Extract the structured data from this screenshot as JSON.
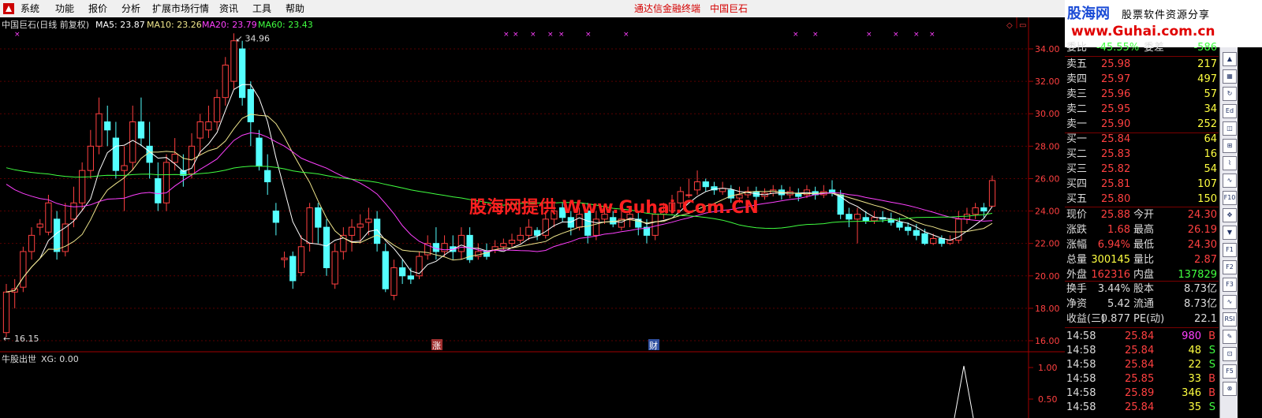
{
  "menu": {
    "items": [
      "系统",
      "功能",
      "报价",
      "分析",
      "扩展市场行情",
      "资讯",
      "工具",
      "帮助"
    ],
    "center_title": "通达信金融终端",
    "center_stock": "中国巨石"
  },
  "banner": {
    "logo_text": "股海网",
    "slogan": "股票软件资源分享",
    "url": "www.Guhai.com.cn"
  },
  "chart_header": {
    "title": "中国巨石(日线 前复权)",
    "ma": [
      {
        "label": "MA5: 23.87",
        "color": "#ffffff"
      },
      {
        "label": "MA10: 23.26",
        "color": "#f0e68c"
      },
      {
        "label": "MA20: 23.79",
        "color": "#ff40ff"
      },
      {
        "label": "MA60: 23.43",
        "color": "#40ff40"
      }
    ]
  },
  "watermark": "股海网提供 Www.Guhai.Com.CN",
  "markers": {
    "zhang": "涨",
    "cai": "财"
  },
  "indicator": {
    "name": "牛股出世",
    "value": "XG: 0.00",
    "axis": [
      "1.00",
      "0.50"
    ]
  },
  "chart_data": {
    "type": "candlestick",
    "y_axis_ticks": [
      "34.00",
      "32.00",
      "30.00",
      "28.00",
      "26.00",
      "24.00",
      "22.00",
      "20.00",
      "18.00",
      "16.00"
    ],
    "ylim": [
      15.4,
      35.4
    ],
    "high_label": "34.96",
    "low_label": "16.15",
    "up_color": "#ff4040",
    "down_color": "#54ffff",
    "candles": [
      {
        "o": 16.5,
        "c": 19.0,
        "h": 19.5,
        "l": 16.2
      },
      {
        "o": 19.0,
        "c": 19.2,
        "h": 19.8,
        "l": 18.0
      },
      {
        "o": 19.3,
        "c": 21.5,
        "h": 21.8,
        "l": 19.0
      },
      {
        "o": 21.5,
        "c": 22.5,
        "h": 23.0,
        "l": 21.0
      },
      {
        "o": 23.0,
        "c": 23.2,
        "h": 23.5,
        "l": 22.5
      },
      {
        "o": 22.7,
        "c": 24.5,
        "h": 25.0,
        "l": 22.5
      },
      {
        "o": 23.5,
        "c": 21.5,
        "h": 24.0,
        "l": 21.0
      },
      {
        "o": 21.5,
        "c": 23.2,
        "h": 24.5,
        "l": 21.2
      },
      {
        "o": 23.5,
        "c": 24.5,
        "h": 25.5,
        "l": 23.0
      },
      {
        "o": 24.5,
        "c": 26.5,
        "h": 27.0,
        "l": 24.0
      },
      {
        "o": 26.5,
        "c": 28.0,
        "h": 29.0,
        "l": 26.0
      },
      {
        "o": 28.0,
        "c": 30.0,
        "h": 31.0,
        "l": 27.5
      },
      {
        "o": 29.5,
        "c": 29.0,
        "h": 30.5,
        "l": 28.0
      },
      {
        "o": 28.5,
        "c": 26.5,
        "h": 29.5,
        "l": 26.0
      },
      {
        "o": 26.5,
        "c": 26.8,
        "h": 28.0,
        "l": 24.0
      },
      {
        "o": 27.0,
        "c": 29.5,
        "h": 30.5,
        "l": 26.5
      },
      {
        "o": 29.5,
        "c": 28.5,
        "h": 31.0,
        "l": 28.0
      },
      {
        "o": 28.0,
        "c": 27.0,
        "h": 29.5,
        "l": 26.0
      },
      {
        "o": 26.0,
        "c": 24.5,
        "h": 27.0,
        "l": 24.0
      },
      {
        "o": 24.5,
        "c": 27.0,
        "h": 27.5,
        "l": 24.0
      },
      {
        "o": 27.0,
        "c": 27.5,
        "h": 28.5,
        "l": 26.5
      },
      {
        "o": 26.5,
        "c": 26.2,
        "h": 27.5,
        "l": 25.5
      },
      {
        "o": 26.3,
        "c": 28.0,
        "h": 28.8,
        "l": 26.0
      },
      {
        "o": 28.5,
        "c": 29.5,
        "h": 30.0,
        "l": 27.5
      },
      {
        "o": 29.0,
        "c": 29.5,
        "h": 30.5,
        "l": 28.5
      },
      {
        "o": 29.5,
        "c": 31.0,
        "h": 31.5,
        "l": 29.0
      },
      {
        "o": 31.0,
        "c": 33.0,
        "h": 33.5,
        "l": 30.5
      },
      {
        "o": 32.0,
        "c": 34.5,
        "h": 34.96,
        "l": 31.5
      },
      {
        "o": 34.0,
        "c": 31.0,
        "h": 34.5,
        "l": 30.5
      },
      {
        "o": 31.5,
        "c": 29.5,
        "h": 32.0,
        "l": 28.0
      },
      {
        "o": 28.5,
        "c": 26.8,
        "h": 29.0,
        "l": 26.5
      },
      {
        "o": 26.5,
        "c": 25.8,
        "h": 27.5,
        "l": 25.0
      },
      {
        "o": 24.0,
        "c": 23.3,
        "h": 24.5,
        "l": 22.5
      },
      {
        "o": 21.0,
        "c": 21.1,
        "h": 21.5,
        "l": 20.5
      },
      {
        "o": 21.2,
        "c": 19.7,
        "h": 21.5,
        "l": 19.2
      },
      {
        "o": 20.2,
        "c": 21.8,
        "h": 22.5,
        "l": 20.0
      },
      {
        "o": 22.0,
        "c": 24.2,
        "h": 24.5,
        "l": 21.5
      },
      {
        "o": 24.2,
        "c": 23.0,
        "h": 24.5,
        "l": 22.0
      },
      {
        "o": 23.0,
        "c": 20.5,
        "h": 23.5,
        "l": 20.0
      },
      {
        "o": 19.5,
        "c": 21.5,
        "h": 22.0,
        "l": 19.2
      },
      {
        "o": 21.5,
        "c": 22.5,
        "h": 23.0,
        "l": 21.0
      },
      {
        "o": 22.5,
        "c": 23.0,
        "h": 23.5,
        "l": 21.5
      },
      {
        "o": 23.0,
        "c": 23.2,
        "h": 23.8,
        "l": 22.0
      },
      {
        "o": 23.3,
        "c": 23.5,
        "h": 24.2,
        "l": 22.5
      },
      {
        "o": 23.5,
        "c": 22.0,
        "h": 24.0,
        "l": 21.5
      },
      {
        "o": 21.5,
        "c": 19.2,
        "h": 22.0,
        "l": 19.0
      },
      {
        "o": 18.8,
        "c": 20.5,
        "h": 21.0,
        "l": 18.5
      },
      {
        "o": 20.5,
        "c": 20.0,
        "h": 21.0,
        "l": 19.5
      },
      {
        "o": 20.0,
        "c": 19.8,
        "h": 20.5,
        "l": 19.5
      },
      {
        "o": 20.0,
        "c": 21.2,
        "h": 21.5,
        "l": 19.8
      },
      {
        "o": 21.3,
        "c": 22.0,
        "h": 22.5,
        "l": 21.0
      },
      {
        "o": 22.0,
        "c": 21.5,
        "h": 23.0,
        "l": 21.0
      },
      {
        "o": 21.5,
        "c": 22.0,
        "h": 22.5,
        "l": 21.2
      },
      {
        "o": 21.8,
        "c": 21.5,
        "h": 22.5,
        "l": 21.0
      },
      {
        "o": 21.5,
        "c": 22.5,
        "h": 23.0,
        "l": 21.0
      },
      {
        "o": 22.5,
        "c": 21.0,
        "h": 23.0,
        "l": 20.8
      },
      {
        "o": 21.2,
        "c": 21.5,
        "h": 22.0,
        "l": 21.0
      },
      {
        "o": 21.5,
        "c": 21.2,
        "h": 22.0,
        "l": 21.0
      },
      {
        "o": 21.6,
        "c": 21.8,
        "h": 22.2,
        "l": 21.4
      },
      {
        "o": 21.8,
        "c": 22.0,
        "h": 22.3,
        "l": 21.6
      },
      {
        "o": 22.0,
        "c": 22.2,
        "h": 22.6,
        "l": 21.8
      },
      {
        "o": 22.2,
        "c": 22.5,
        "h": 23.0,
        "l": 22.0
      },
      {
        "o": 22.5,
        "c": 23.0,
        "h": 23.5,
        "l": 22.2
      },
      {
        "o": 22.8,
        "c": 22.5,
        "h": 23.0,
        "l": 22.2
      },
      {
        "o": 22.5,
        "c": 23.5,
        "h": 24.0,
        "l": 22.3
      },
      {
        "o": 23.5,
        "c": 24.0,
        "h": 24.5,
        "l": 23.0
      },
      {
        "o": 24.2,
        "c": 23.6,
        "h": 24.5,
        "l": 23.3
      },
      {
        "o": 23.6,
        "c": 23.0,
        "h": 24.0,
        "l": 22.5
      },
      {
        "o": 23.0,
        "c": 23.8,
        "h": 24.2,
        "l": 22.8
      },
      {
        "o": 24.0,
        "c": 22.5,
        "h": 24.5,
        "l": 22.0
      },
      {
        "o": 22.5,
        "c": 23.5,
        "h": 24.0,
        "l": 22.2
      },
      {
        "o": 23.5,
        "c": 23.8,
        "h": 24.2,
        "l": 23.2
      },
      {
        "o": 23.6,
        "c": 23.2,
        "h": 24.0,
        "l": 23.0
      },
      {
        "o": 23.0,
        "c": 23.5,
        "h": 24.0,
        "l": 22.8
      },
      {
        "o": 23.5,
        "c": 23.8,
        "h": 24.2,
        "l": 23.0
      },
      {
        "o": 23.5,
        "c": 23.0,
        "h": 24.0,
        "l": 22.5
      },
      {
        "o": 23.0,
        "c": 22.5,
        "h": 23.5,
        "l": 22.0
      },
      {
        "o": 22.5,
        "c": 23.8,
        "h": 24.0,
        "l": 22.2
      },
      {
        "o": 23.8,
        "c": 24.0,
        "h": 24.5,
        "l": 23.5
      },
      {
        "o": 24.0,
        "c": 24.5,
        "h": 25.0,
        "l": 23.8
      },
      {
        "o": 24.5,
        "c": 25.2,
        "h": 25.5,
        "l": 24.2
      },
      {
        "o": 25.0,
        "c": 25.0,
        "h": 26.0,
        "l": 24.8
      },
      {
        "o": 25.3,
        "c": 25.8,
        "h": 26.5,
        "l": 25.0
      },
      {
        "o": 25.8,
        "c": 25.5,
        "h": 26.0,
        "l": 25.2
      },
      {
        "o": 25.5,
        "c": 25.3,
        "h": 25.8,
        "l": 25.0
      },
      {
        "o": 25.2,
        "c": 25.4,
        "h": 25.8,
        "l": 25.0
      },
      {
        "o": 25.3,
        "c": 24.8,
        "h": 25.6,
        "l": 24.5
      },
      {
        "o": 24.8,
        "c": 25.0,
        "h": 25.5,
        "l": 24.5
      },
      {
        "o": 25.0,
        "c": 25.2,
        "h": 25.5,
        "l": 24.8
      },
      {
        "o": 25.2,
        "c": 24.9,
        "h": 25.5,
        "l": 24.6
      },
      {
        "o": 24.9,
        "c": 25.1,
        "h": 25.4,
        "l": 24.7
      },
      {
        "o": 25.1,
        "c": 25.3,
        "h": 25.6,
        "l": 24.9
      },
      {
        "o": 25.3,
        "c": 25.0,
        "h": 25.6,
        "l": 24.7
      },
      {
        "o": 25.0,
        "c": 25.2,
        "h": 25.5,
        "l": 24.8
      },
      {
        "o": 25.1,
        "c": 24.9,
        "h": 25.4,
        "l": 24.6
      },
      {
        "o": 25.0,
        "c": 25.3,
        "h": 25.6,
        "l": 24.8
      },
      {
        "o": 25.2,
        "c": 25.0,
        "h": 25.5,
        "l": 24.7
      },
      {
        "o": 25.0,
        "c": 25.2,
        "h": 25.6,
        "l": 24.8
      },
      {
        "o": 25.3,
        "c": 25.1,
        "h": 25.9,
        "l": 24.9
      },
      {
        "o": 25.0,
        "c": 23.8,
        "h": 25.3,
        "l": 23.5
      },
      {
        "o": 23.8,
        "c": 23.5,
        "h": 24.2,
        "l": 23.0
      },
      {
        "o": 23.5,
        "c": 23.8,
        "h": 24.2,
        "l": 22.0
      },
      {
        "o": 23.6,
        "c": 23.4,
        "h": 24.0,
        "l": 23.2
      },
      {
        "o": 23.4,
        "c": 23.6,
        "h": 24.0,
        "l": 23.2
      },
      {
        "o": 23.6,
        "c": 23.5,
        "h": 24.0,
        "l": 23.3
      },
      {
        "o": 23.5,
        "c": 23.3,
        "h": 23.9,
        "l": 23.1
      },
      {
        "o": 23.3,
        "c": 23.0,
        "h": 23.6,
        "l": 22.8
      },
      {
        "o": 23.0,
        "c": 22.8,
        "h": 23.3,
        "l": 22.5
      },
      {
        "o": 22.8,
        "c": 22.5,
        "h": 23.2,
        "l": 22.2
      },
      {
        "o": 22.6,
        "c": 22.0,
        "h": 22.9,
        "l": 21.9
      },
      {
        "o": 22.0,
        "c": 22.3,
        "h": 22.6,
        "l": 21.9
      },
      {
        "o": 22.3,
        "c": 22.0,
        "h": 22.5,
        "l": 21.8
      },
      {
        "o": 22.0,
        "c": 22.2,
        "h": 22.5,
        "l": 21.9
      },
      {
        "o": 22.2,
        "c": 23.5,
        "h": 24.0,
        "l": 22.0
      },
      {
        "o": 23.5,
        "c": 23.8,
        "h": 24.2,
        "l": 23.2
      },
      {
        "o": 23.8,
        "c": 24.2,
        "h": 24.5,
        "l": 23.5
      },
      {
        "o": 24.2,
        "c": 24.0,
        "h": 24.5,
        "l": 23.6
      },
      {
        "o": 24.3,
        "c": 25.88,
        "h": 26.19,
        "l": 24.3
      }
    ]
  },
  "quote_panel": {
    "top_partial": {
      "label": "委比",
      "value": "-45.55%",
      "label2": "委差",
      "value2": "-586"
    },
    "asks": [
      {
        "label": "卖五",
        "price": "25.98",
        "vol": "217"
      },
      {
        "label": "卖四",
        "price": "25.97",
        "vol": "497"
      },
      {
        "label": "卖三",
        "price": "25.96",
        "vol": "57"
      },
      {
        "label": "卖二",
        "price": "25.95",
        "vol": "34"
      },
      {
        "label": "卖一",
        "price": "25.90",
        "vol": "252"
      }
    ],
    "bids": [
      {
        "label": "买一",
        "price": "25.84",
        "vol": "64"
      },
      {
        "label": "买二",
        "price": "25.83",
        "vol": "16"
      },
      {
        "label": "买三",
        "price": "25.82",
        "vol": "54"
      },
      {
        "label": "买四",
        "price": "25.81",
        "vol": "107"
      },
      {
        "label": "买五",
        "price": "25.80",
        "vol": "150"
      }
    ],
    "stats": [
      {
        "l1": "现价",
        "v1": "25.88",
        "l2": "今开",
        "v2": "24.30",
        "c1": "#ff4040",
        "c2": "#ff4040"
      },
      {
        "l1": "涨跌",
        "v1": "1.68",
        "l2": "最高",
        "v2": "26.19",
        "c1": "#ff4040",
        "c2": "#ff4040"
      },
      {
        "l1": "涨幅",
        "v1": "6.94%",
        "l2": "最低",
        "v2": "24.30",
        "c1": "#ff4040",
        "c2": "#ff4040"
      },
      {
        "l1": "总量",
        "v1": "300145",
        "l2": "量比",
        "v2": "2.87",
        "c1": "#ffff40",
        "c2": "#ff4040"
      },
      {
        "l1": "外盘",
        "v1": "162316",
        "l2": "内盘",
        "v2": "137829",
        "c1": "#ff4040",
        "c2": "#40ff40"
      }
    ],
    "stats2": [
      {
        "l1": "换手",
        "v1": "3.44%",
        "l2": "股本",
        "v2": "8.73亿"
      },
      {
        "l1": "净资",
        "v1": "5.42",
        "l2": "流通",
        "v2": "8.73亿"
      },
      {
        "l1": "收益(三)",
        "v1": "0.877",
        "l2": "PE(动)",
        "v2": "22.1"
      }
    ],
    "ticks": [
      {
        "time": "14:58",
        "price": "25.84",
        "vol": "980",
        "side": "B",
        "vcolor": "#ff40ff"
      },
      {
        "time": "14:58",
        "price": "25.84",
        "vol": "48",
        "side": "S",
        "vcolor": "#ffff40"
      },
      {
        "time": "14:58",
        "price": "25.84",
        "vol": "22",
        "side": "S",
        "vcolor": "#ffff40"
      },
      {
        "time": "14:58",
        "price": "25.85",
        "vol": "33",
        "side": "B",
        "vcolor": "#ffff40"
      },
      {
        "time": "14:58",
        "price": "25.89",
        "vol": "346",
        "side": "B",
        "vcolor": "#ffff40"
      },
      {
        "time": "14:58",
        "price": "25.84",
        "vol": "35",
        "side": "S",
        "vcolor": "#ffff40"
      }
    ]
  },
  "tool_icons": [
    "▲",
    "▦",
    "↻",
    "Ed",
    "◫",
    "⊞",
    "⌇",
    "∿",
    "F10",
    "✥",
    "▼",
    "F1",
    "F2",
    "F3",
    "∿",
    "RSI",
    "✎",
    "⊡",
    "F5",
    "⊗"
  ]
}
